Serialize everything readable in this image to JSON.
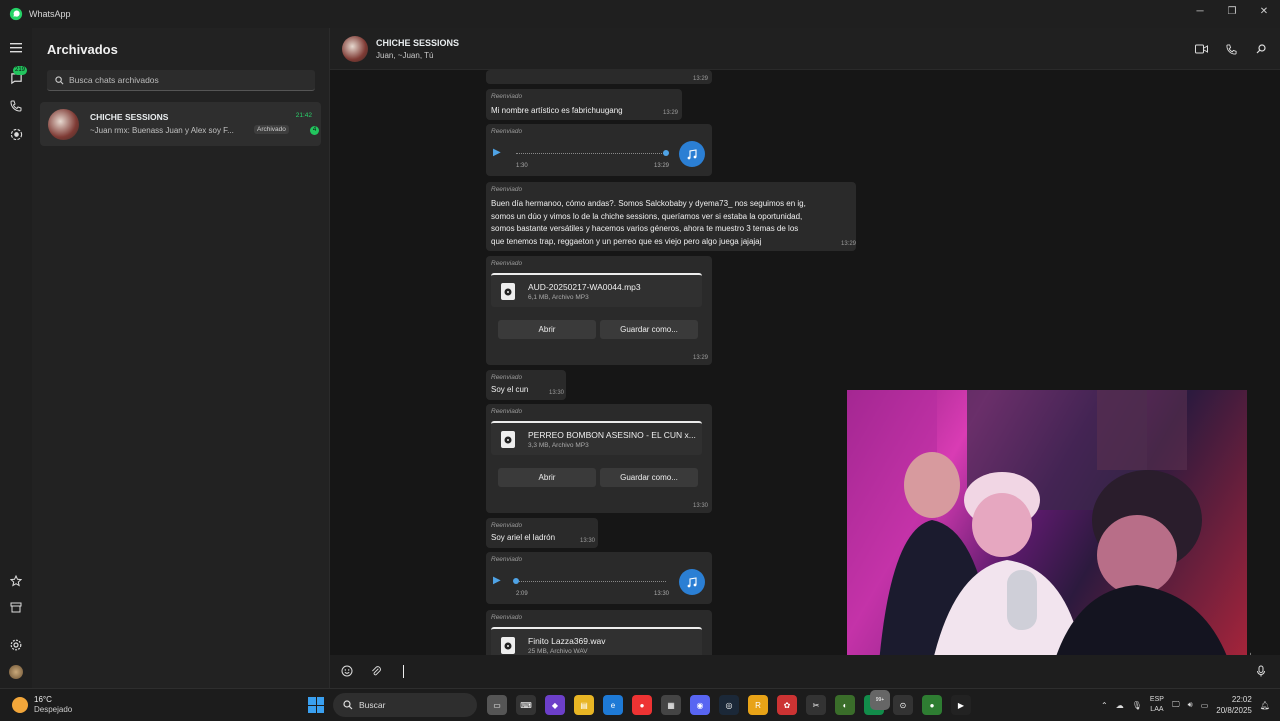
{
  "window": {
    "title": "WhatsApp"
  },
  "rail": {
    "badge1": "219",
    "badge2": ""
  },
  "sidebar": {
    "title": "Archivados",
    "search_placeholder": "Busca chats archivados",
    "chat": {
      "name": "CHICHE SESSIONS",
      "time": "21:42",
      "preview": "~Juan rmx: Buenass Juan y Alex soy F...",
      "tag": "Archivado",
      "unread": "4"
    }
  },
  "header": {
    "name": "CHICHE SESSIONS",
    "members": "Juan, ~Juan, Tú"
  },
  "messages": {
    "m0_time": "13:29",
    "fwd": "Reenviado",
    "m1_text": "Mi nombre artístico es fabrichuugang",
    "m1_time": "13:29",
    "m2_dur": "1:30",
    "m2_time": "13:29",
    "m3_lines": [
      "Buen día hermanoo, cómo andas?. Somos Salckobaby y dyema73_ nos seguimos en ig,",
      "somos un dúo y vimos lo de la chiche sessions, queríamos ver si estaba la oportunidad,",
      "somos bastante versátiles y hacemos varios géneros, ahora te muestro 3 temas de los",
      "que tenemos trap, reggaeton y un perreo que es viejo pero algo juega jajajaj"
    ],
    "m3_time": "13:29",
    "m4_file": "AUD-20250217-WA0044.mp3",
    "m4_meta": "6,1 MB, Archivo MP3",
    "m4_time": "13:29",
    "open": "Abrir",
    "save": "Guardar como...",
    "m5_text": "Soy el cun",
    "m5_time": "13:30",
    "m6_file": "PERREO BOMBON ASESINO - EL CUN x...",
    "m6_meta": "3,3 MB, Archivo MP3",
    "m6_time": "13:30",
    "m7_text": "Soy ariel el ladrón",
    "m7_time": "13:30",
    "m8_dur": "2:09",
    "m8_time": "13:30",
    "m9_file": "Finito Lazza369.wav",
    "m9_meta": "25 MB, Archivo WAV"
  },
  "taskbar": {
    "temp": "16°C",
    "weather": "Despejado",
    "search": "Buscar",
    "lang1": "ESP",
    "lang2": "LAA",
    "time": "22:02",
    "date": "20/8/2025",
    "badge": "99+"
  },
  "colors": {
    "accent": "#22c55e",
    "link": "#2b7fd4"
  }
}
